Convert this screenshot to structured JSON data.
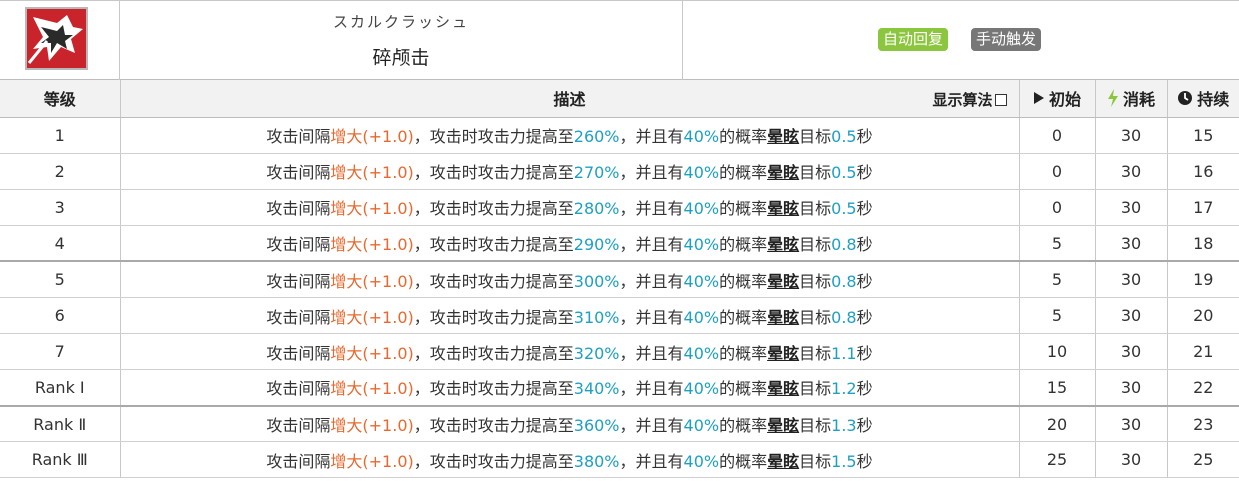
{
  "skill": {
    "name_jp": "スカルクラッシュ",
    "name_cn": "碎颅击",
    "badges": [
      "自动回复",
      "手动触发"
    ],
    "icon": "skull-crush-icon"
  },
  "table": {
    "headers": {
      "level": "等级",
      "description": "描述",
      "show_formula": "显示算法",
      "initial": "初始",
      "cost": "消耗",
      "duration": "持续"
    },
    "desc_parts": {
      "p1": "攻击间隔",
      "p2": "增大(+1.0)",
      "p3": "，攻击时攻击力提高至",
      "p5": "，并且有",
      "p6": "40%",
      "p7": "的概率",
      "p8": "晕眩",
      "p9": "目标",
      "p11": "秒"
    },
    "rows": [
      {
        "level": "1",
        "atk": "260%",
        "stun": "0.5",
        "initial": "0",
        "cost": "30",
        "duration": "15"
      },
      {
        "level": "2",
        "atk": "270%",
        "stun": "0.5",
        "initial": "0",
        "cost": "30",
        "duration": "16"
      },
      {
        "level": "3",
        "atk": "280%",
        "stun": "0.5",
        "initial": "0",
        "cost": "30",
        "duration": "17"
      },
      {
        "level": "4",
        "atk": "290%",
        "stun": "0.8",
        "initial": "5",
        "cost": "30",
        "duration": "18"
      },
      {
        "level": "5",
        "atk": "300%",
        "stun": "0.8",
        "initial": "5",
        "cost": "30",
        "duration": "19"
      },
      {
        "level": "6",
        "atk": "310%",
        "stun": "0.8",
        "initial": "5",
        "cost": "30",
        "duration": "20"
      },
      {
        "level": "7",
        "atk": "320%",
        "stun": "1.1",
        "initial": "10",
        "cost": "30",
        "duration": "21"
      },
      {
        "level": "Rank Ⅰ",
        "atk": "340%",
        "stun": "1.2",
        "initial": "15",
        "cost": "30",
        "duration": "22"
      },
      {
        "level": "Rank Ⅱ",
        "atk": "360%",
        "stun": "1.3",
        "initial": "20",
        "cost": "30",
        "duration": "23"
      },
      {
        "level": "Rank Ⅲ",
        "atk": "380%",
        "stun": "1.5",
        "initial": "25",
        "cost": "30",
        "duration": "25"
      }
    ]
  },
  "colors": {
    "accent_orange": "#e8692f",
    "accent_blue": "#1ea0c3",
    "badge_green": "#8cc63f",
    "badge_gray": "#777777",
    "header_bg": "#f2f2f2"
  }
}
